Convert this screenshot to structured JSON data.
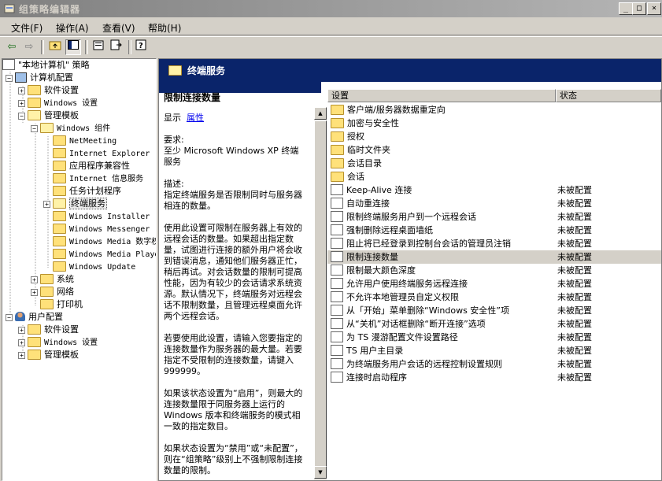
{
  "window": {
    "title": "组策略编辑器"
  },
  "menu": [
    "文件(F)",
    "操作(A)",
    "查看(V)",
    "帮助(H)"
  ],
  "tree": [
    {
      "label": "\"本地计算机\" 策略",
      "icon": "policy-icon",
      "expander": ""
    },
    {
      "label": "计算机配置",
      "icon": "computer-icon",
      "expander": "−"
    },
    {
      "label": "软件设置",
      "icon": "folder-icon",
      "expander": "+"
    },
    {
      "label": "Windows 设置",
      "icon": "folder-icon",
      "expander": "+"
    },
    {
      "label": "管理模板",
      "icon": "folder-open-icon",
      "expander": "−"
    },
    {
      "label": "Windows 组件",
      "icon": "folder-open-icon",
      "expander": "−"
    },
    {
      "label": "NetMeeting",
      "icon": "folder-icon",
      "expander": ""
    },
    {
      "label": "Internet Explorer",
      "icon": "folder-icon",
      "expander": ""
    },
    {
      "label": "应用程序兼容性",
      "icon": "folder-icon",
      "expander": ""
    },
    {
      "label": "Internet 信息服务",
      "icon": "folder-icon",
      "expander": ""
    },
    {
      "label": "任务计划程序",
      "icon": "folder-icon",
      "expander": ""
    },
    {
      "label": "终端服务",
      "icon": "folder-open-icon",
      "expander": "+"
    },
    {
      "label": "Windows Installer",
      "icon": "folder-icon",
      "expander": ""
    },
    {
      "label": "Windows Messenger",
      "icon": "folder-icon",
      "expander": ""
    },
    {
      "label": "Windows Media 数字权限",
      "icon": "folder-icon",
      "expander": ""
    },
    {
      "label": "Windows Media Player",
      "icon": "folder-icon",
      "expander": ""
    },
    {
      "label": "Windows Update",
      "icon": "folder-icon",
      "expander": ""
    },
    {
      "label": "系统",
      "icon": "folder-icon",
      "expander": "+"
    },
    {
      "label": "网络",
      "icon": "folder-icon",
      "expander": "+"
    },
    {
      "label": "打印机",
      "icon": "folder-icon",
      "expander": ""
    },
    {
      "label": "用户配置",
      "icon": "user-icon",
      "expander": "−"
    },
    {
      "label": "软件设置",
      "icon": "folder-icon",
      "expander": "+"
    },
    {
      "label": "Windows 设置",
      "icon": "folder-icon",
      "expander": "+"
    },
    {
      "label": "管理模板",
      "icon": "folder-icon",
      "expander": "+"
    }
  ],
  "right": {
    "header": "终端服务",
    "desc": {
      "title": "限制连接数量",
      "show_prefix": "显示",
      "show_link": "属性",
      "p1": "要求:\n至少 Microsoft Windows XP 终端服务",
      "p2": "描述:\n指定终端服务是否限制同时与服务器相连的数量。",
      "p3": "使用此设置可限制在服务器上有效的远程会话的数量。如果超出指定数量，试图进行连接的额外用户将会收到错误消息，通知他们服务器正忙，稍后再试。对会话数量的限制可提高性能，因为有较少的会话请求系统资源。默认情况下，终端服务对远程会话不限制数量，且管理远程桌面允许两个远程会话。",
      "p4": "若要使用此设置，请输入您要指定的连接数量作为服务器的最大量。若要指定不受限制的连接数量，请键入 999999。",
      "p5": "如果该状态设置为“启用”，则最大的连接数量限于同服务器上运行的 Windows 版本和终端服务的模式相一致的指定数目。",
      "p6": "如果状态设置为“禁用”或“未配置”，则在“组策略”级别上不强制限制连接数量的限制。"
    },
    "columns": {
      "setting": "设置",
      "state": "状态"
    },
    "rows": [
      {
        "name": "客户端/服务器数据重定向",
        "state": "",
        "kind": "folder"
      },
      {
        "name": "加密与安全性",
        "state": "",
        "kind": "folder"
      },
      {
        "name": "授权",
        "state": "",
        "kind": "folder"
      },
      {
        "name": "临时文件夹",
        "state": "",
        "kind": "folder"
      },
      {
        "name": "会话目录",
        "state": "",
        "kind": "folder"
      },
      {
        "name": "会话",
        "state": "",
        "kind": "folder"
      },
      {
        "name": "Keep-Alive 连接",
        "state": "未被配置",
        "kind": "setting"
      },
      {
        "name": "自动重连接",
        "state": "未被配置",
        "kind": "setting"
      },
      {
        "name": "限制终端服务用户到一个远程会话",
        "state": "未被配置",
        "kind": "setting"
      },
      {
        "name": "强制删除远程桌面墙纸",
        "state": "未被配置",
        "kind": "setting"
      },
      {
        "name": "阻止将已经登录到控制台会话的管理员注销",
        "state": "未被配置",
        "kind": "setting"
      },
      {
        "name": "限制连接数量",
        "state": "未被配置",
        "kind": "setting",
        "selected": true
      },
      {
        "name": "限制最大颜色深度",
        "state": "未被配置",
        "kind": "setting"
      },
      {
        "name": "允许用户使用终端服务远程连接",
        "state": "未被配置",
        "kind": "setting"
      },
      {
        "name": "不允许本地管理员自定义权限",
        "state": "未被配置",
        "kind": "setting"
      },
      {
        "name": "从「开始」菜单删除“Windows 安全性”项",
        "state": "未被配置",
        "kind": "setting"
      },
      {
        "name": "从“关机”对话框删除“断开连接”选项",
        "state": "未被配置",
        "kind": "setting"
      },
      {
        "name": "为 TS 漫游配置文件设置路径",
        "state": "未被配置",
        "kind": "setting"
      },
      {
        "name": "TS 用户主目录",
        "state": "未被配置",
        "kind": "setting"
      },
      {
        "name": "为终端服务用户会话的远程控制设置规则",
        "state": "未被配置",
        "kind": "setting"
      },
      {
        "name": "连接时启动程序",
        "state": "未被配置",
        "kind": "setting"
      }
    ]
  }
}
